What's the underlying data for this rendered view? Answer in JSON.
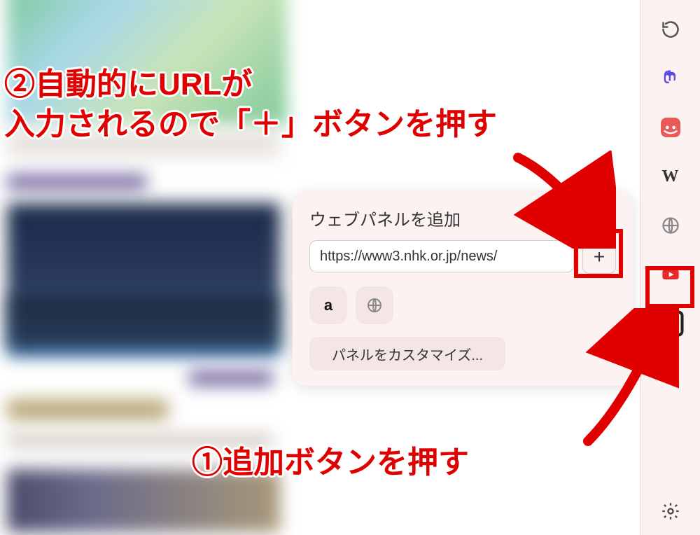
{
  "popup": {
    "title": "ウェブパネルを追加",
    "url_value": "https://www3.nhk.or.jp/news/",
    "plus_label": "+",
    "quick": {
      "amazon_label": "a",
      "globe_label": "globe"
    },
    "customize_label": "パネルをカスタマイズ..."
  },
  "sidebar": {
    "items": [
      {
        "name": "refresh-icon"
      },
      {
        "name": "mastodon-icon"
      },
      {
        "name": "notes-icon"
      },
      {
        "name": "wikipedia-icon",
        "label": "W"
      },
      {
        "name": "globe-icon"
      },
      {
        "name": "youtube-icon"
      }
    ],
    "add_panel_label": "+",
    "settings_label": "settings"
  },
  "annotations": {
    "step2_line1": "②自動的にURLが",
    "step2_line2": "入力されるので「＋」ボタンを押す",
    "step1": "①追加ボタンを押す"
  },
  "highlights": {
    "plus_button": true,
    "sidebar_add_button": true
  }
}
